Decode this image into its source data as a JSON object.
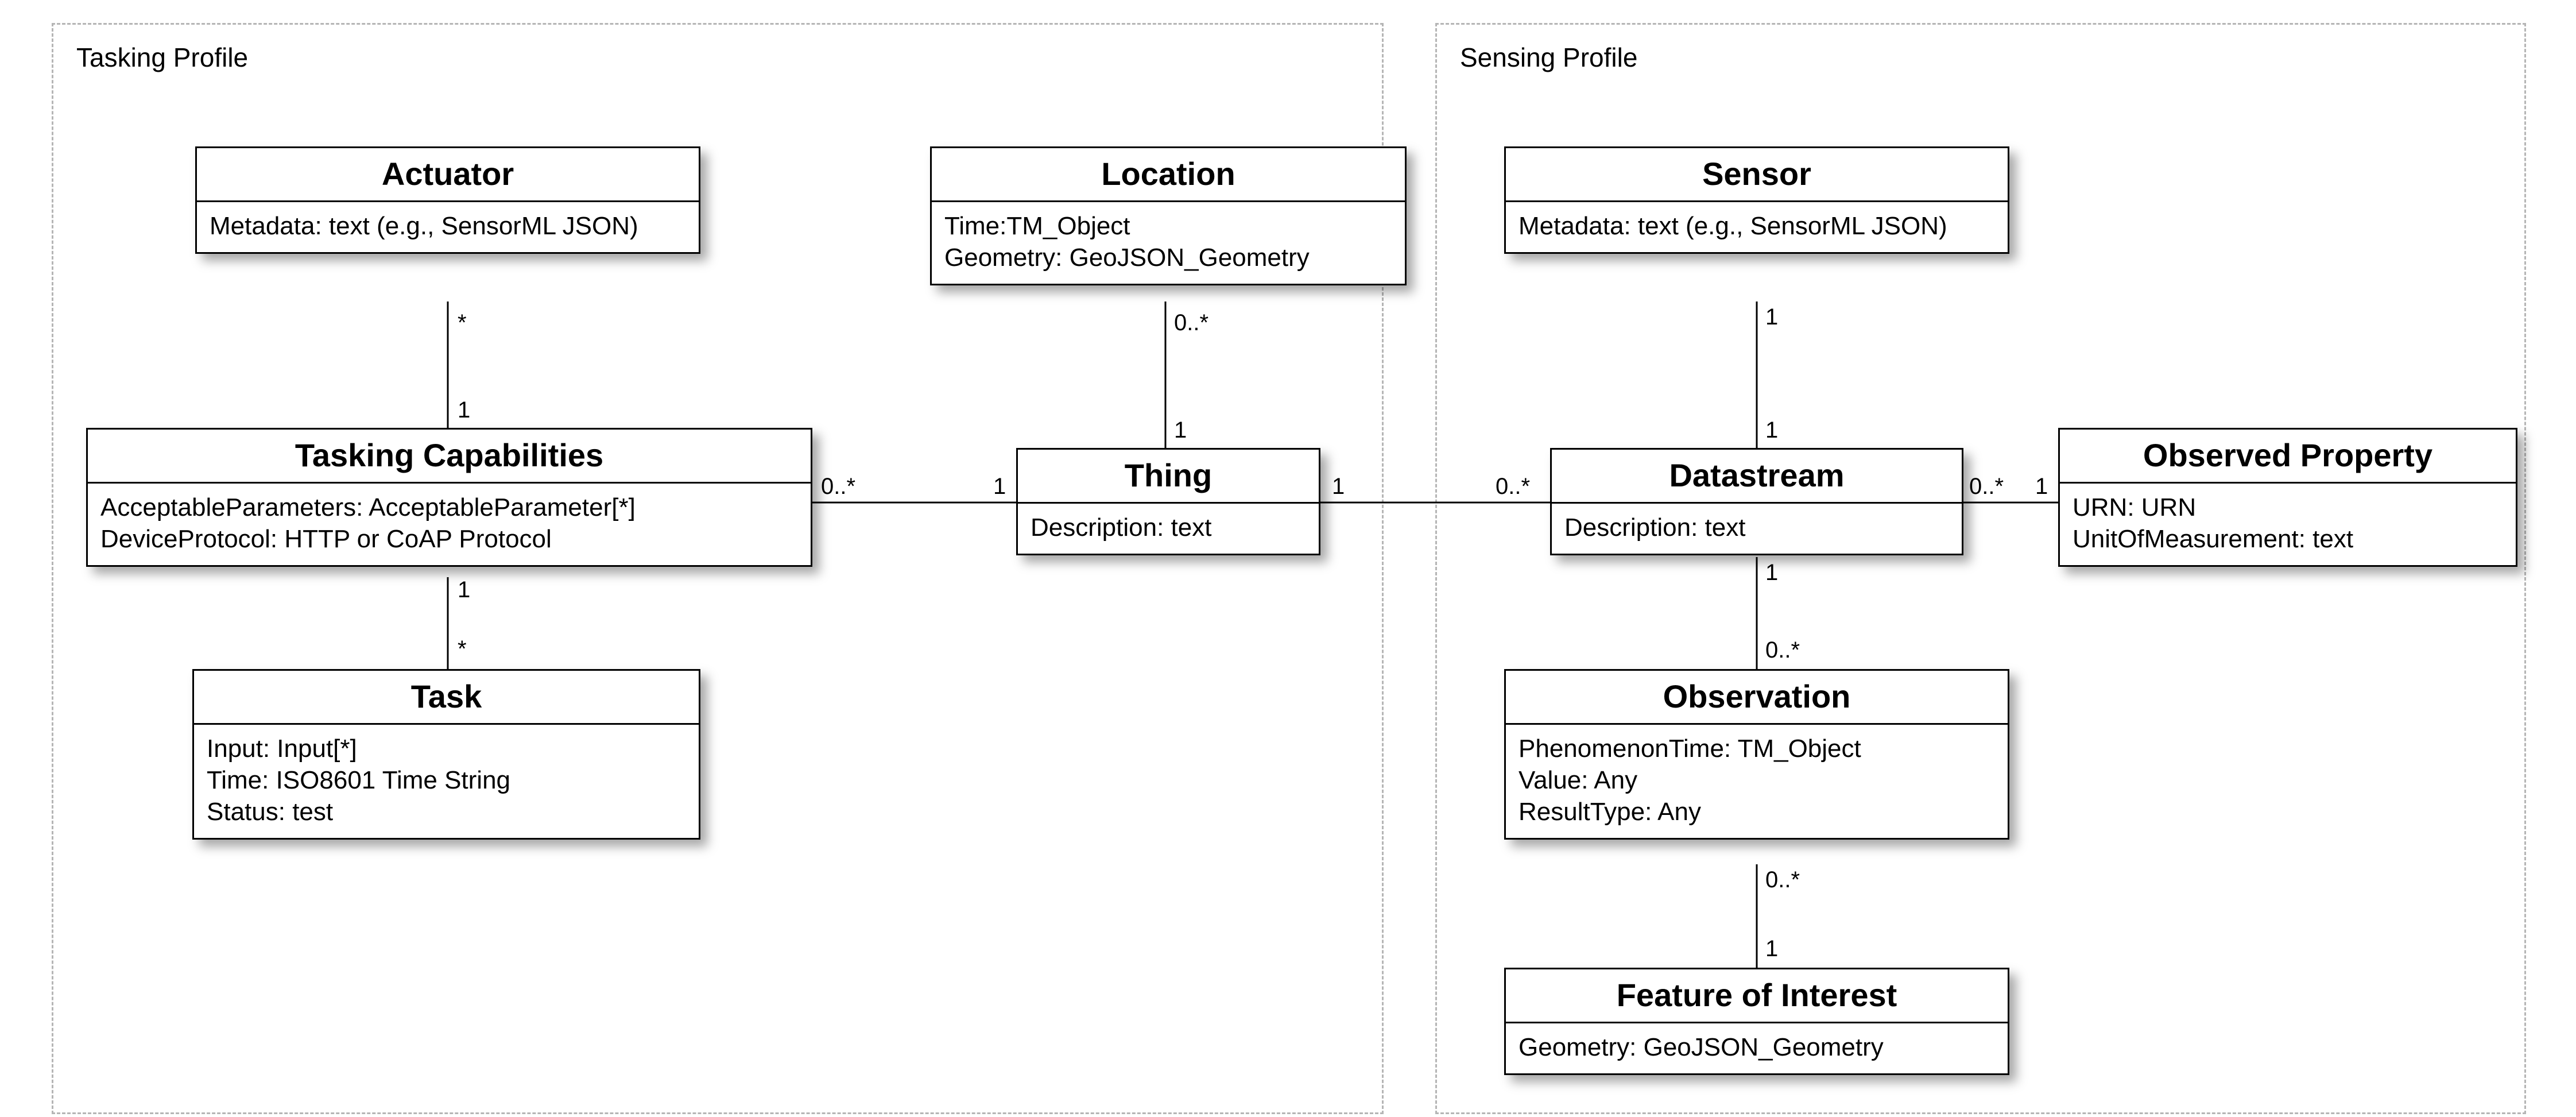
{
  "profiles": {
    "tasking": {
      "label": "Tasking Profile"
    },
    "sensing": {
      "label": "Sensing Profile"
    }
  },
  "classes": {
    "actuator": {
      "title": "Actuator",
      "attrs": [
        "Metadata: text (e.g., SensorML JSON)"
      ]
    },
    "tasking_caps": {
      "title": "Tasking Capabilities",
      "attrs": [
        "AcceptableParameters: AcceptableParameter[*]",
        "DeviceProtocol: HTTP or CoAP Protocol"
      ]
    },
    "task": {
      "title": "Task",
      "attrs": [
        "Input: Input[*]",
        "Time: ISO8601 Time String",
        "Status: test"
      ]
    },
    "location": {
      "title": "Location",
      "attrs": [
        "Time:TM_Object",
        "Geometry: GeoJSON_Geometry"
      ]
    },
    "thing": {
      "title": "Thing",
      "attrs": [
        "Description: text"
      ]
    },
    "sensor": {
      "title": "Sensor",
      "attrs": [
        "Metadata: text (e.g., SensorML JSON)"
      ]
    },
    "datastream": {
      "title": "Datastream",
      "attrs": [
        "Description: text"
      ]
    },
    "observed_property": {
      "title": "Observed Property",
      "attrs": [
        "URN: URN",
        "UnitOfMeasurement: text"
      ]
    },
    "observation": {
      "title": "Observation",
      "attrs": [
        "PhenomenonTime: TM_Object",
        "Value: Any",
        "ResultType: Any"
      ]
    },
    "feature": {
      "title": "Feature of Interest",
      "attrs": [
        "Geometry: GeoJSON_Geometry"
      ]
    }
  },
  "mults": {
    "actuator_bottom": "*",
    "tc_top": "1",
    "tc_right": "0..*",
    "thing_left": "1",
    "tc_bottom": "1",
    "task_top": "*",
    "location_bottom": "0..*",
    "thing_top": "1",
    "thing_right": "1",
    "ds_left": "0..*",
    "sensor_bottom": "1",
    "ds_top": "1",
    "ds_right": "0..*",
    "op_left": "1",
    "ds_bottom": "1",
    "obs_top": "0..*",
    "obs_bottom": "0..*",
    "feature_top": "1"
  }
}
